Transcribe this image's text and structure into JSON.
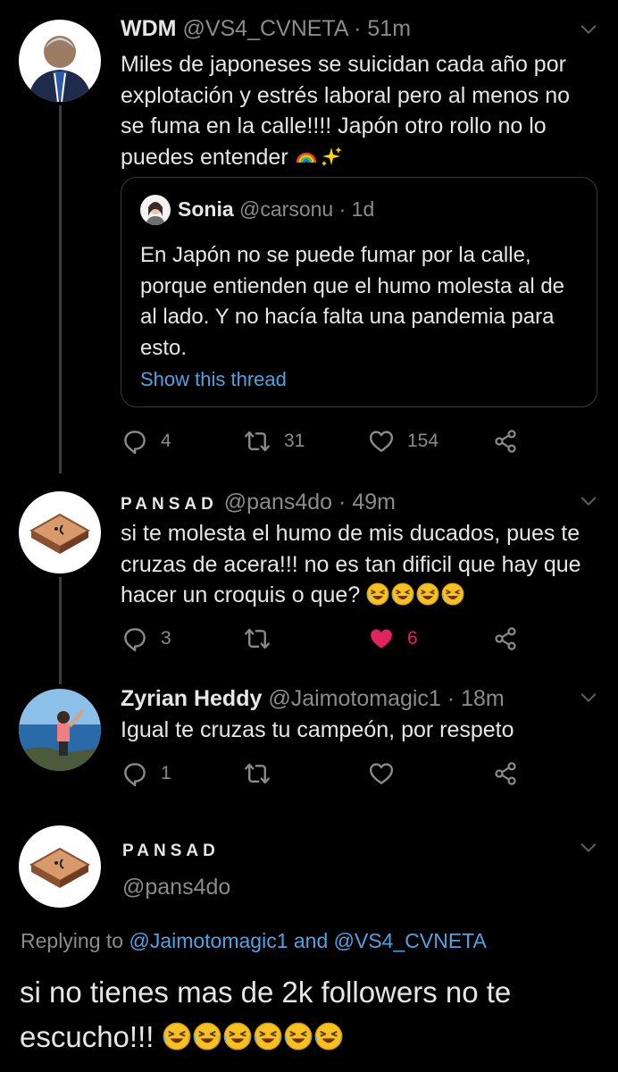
{
  "tweet1": {
    "name": "WDM",
    "handle": "@VS4_CVNETA",
    "time": "51m",
    "text": "Miles de japoneses se suicidan cada año por explotación y estrés laboral pero al menos no se fuma en la calle!!!! Japón otro rollo no lo puedes entender",
    "quote": {
      "name": "Sonia",
      "handle": "@carsonu",
      "time": "1d",
      "text": "En Japón no se puede fumar por la calle, porque entienden que el humo molesta al de al lado. Y no hacía falta una pandemia para esto.",
      "show_thread": "Show this thread"
    },
    "replies": "4",
    "retweets": "31",
    "likes": "154"
  },
  "tweet2": {
    "name": "PANSAD",
    "handle": "@pans4do",
    "time": "49m",
    "text": "si te molesta el humo de mis ducados, pues te cruzas de acera!!! no es tan dificil que hay que hacer un croquis o que?",
    "replies": "3",
    "retweets": "",
    "likes": "6"
  },
  "tweet3": {
    "name": "Zyrian Heddy",
    "handle": "@Jaimotomagic1",
    "time": "18m",
    "text": "Igual te cruzas tu campeón, por respeto",
    "replies": "1",
    "retweets": "",
    "likes": ""
  },
  "main": {
    "name": "PANSAD",
    "handle": "@pans4do",
    "replying_prefix": "Replying to",
    "replying_user1": "@Jaimotomagic1",
    "replying_and": "and",
    "replying_user2": "@VS4_CVNETA",
    "text": "si no tienes mas de 2k followers no te escucho!!!"
  },
  "separator_dot": "·",
  "colors": {
    "background": "#000000",
    "link": "#4ea3e3",
    "like_active": "#e0245e",
    "muted": "#8b8b8b"
  }
}
